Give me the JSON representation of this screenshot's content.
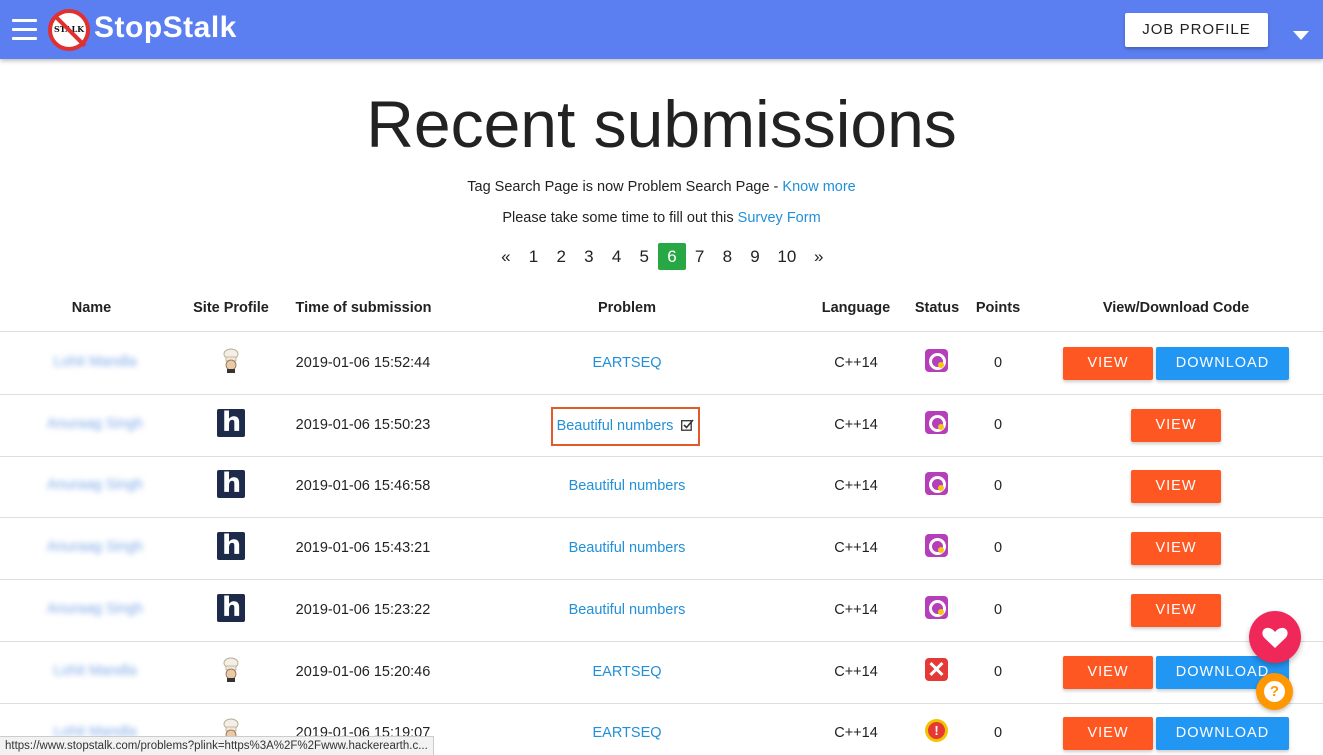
{
  "nav": {
    "brand": "StopStalk",
    "logo_text": "STALK",
    "job_profile_label": "JOB PROFILE",
    "bg_color": "#5b7ff0"
  },
  "page": {
    "title": "Recent submissions",
    "notice1_text": "Tag Search Page is now Problem Search Page - ",
    "notice1_link": "Know more",
    "notice2_text": "Please take some time to fill out this ",
    "notice2_link": "Survey Form"
  },
  "pagination": {
    "prev": "«",
    "pages": [
      "1",
      "2",
      "3",
      "4",
      "5",
      "6",
      "7",
      "8",
      "9",
      "10"
    ],
    "active_page": "6",
    "next": "»"
  },
  "table": {
    "headers": {
      "name": "Name",
      "site_profile": "Site Profile",
      "time": "Time of submission",
      "problem": "Problem",
      "language": "Language",
      "status": "Status",
      "points": "Points",
      "code": "View/Download Code"
    },
    "view_label": "VIEW",
    "download_label": "DOWNLOAD",
    "rows": [
      {
        "name": "Lohit Mandla",
        "site": "codechef",
        "time": "2019-01-06 15:52:44",
        "problem": "EARTSEQ",
        "language": "C++14",
        "status": "partially-correct",
        "points": "0",
        "download": true
      },
      {
        "name": "Anuraag Singh",
        "site": "hackerearth",
        "time": "2019-01-06 15:50:23",
        "problem": "Beautiful numbers",
        "language": "C++14",
        "status": "partially-correct",
        "points": "0",
        "download": false,
        "highlighted": true
      },
      {
        "name": "Anuraag Singh",
        "site": "hackerearth",
        "time": "2019-01-06 15:46:58",
        "problem": "Beautiful numbers",
        "language": "C++14",
        "status": "partially-correct",
        "points": "0",
        "download": false
      },
      {
        "name": "Anuraag Singh",
        "site": "hackerearth",
        "time": "2019-01-06 15:43:21",
        "problem": "Beautiful numbers",
        "language": "C++14",
        "status": "partially-correct",
        "points": "0",
        "download": false
      },
      {
        "name": "Anuraag Singh",
        "site": "hackerearth",
        "time": "2019-01-06 15:23:22",
        "problem": "Beautiful numbers",
        "language": "C++14",
        "status": "partially-correct",
        "points": "0",
        "download": false
      },
      {
        "name": "Lohit Mandla",
        "site": "codechef",
        "time": "2019-01-06 15:20:46",
        "problem": "EARTSEQ",
        "language": "C++14",
        "status": "wrong-answer",
        "points": "0",
        "download": true
      },
      {
        "name": "Lohit Mandla",
        "site": "codechef",
        "time": "2019-01-06 15:19:07",
        "problem": "EARTSEQ",
        "language": "C++14",
        "status": "time-limit-exceeded",
        "points": "0",
        "download": true
      }
    ]
  },
  "status_bar": {
    "url": "https://www.stopstalk.com/problems?plink=https%3A%2F%2Fwww.hackerearth.c..."
  },
  "icons": {
    "hamburger": "menu-icon",
    "caret": "chevron-down-icon",
    "heart": "heart-icon",
    "help": "help-icon",
    "checklist": "checkbox-icon"
  }
}
